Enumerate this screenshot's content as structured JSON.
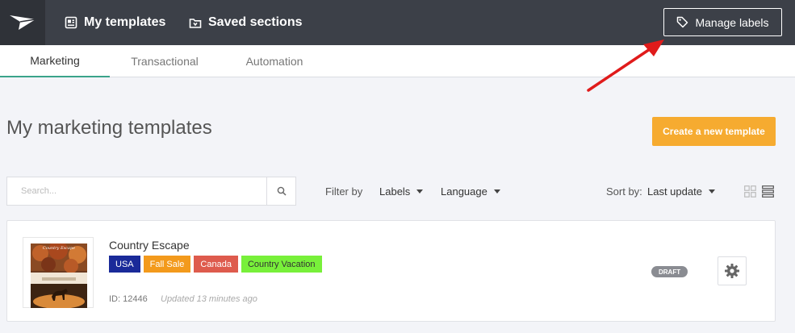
{
  "header": {
    "logo_icon": "paper-plane-icon",
    "nav": [
      {
        "label": "My templates",
        "icon": "templates-icon"
      },
      {
        "label": "Saved sections",
        "icon": "folder-icon"
      }
    ],
    "manage_labels": {
      "label": "Manage labels",
      "icon": "tag-icon"
    }
  },
  "tabs": [
    {
      "label": "Marketing",
      "active": true
    },
    {
      "label": "Transactional",
      "active": false
    },
    {
      "label": "Automation",
      "active": false
    }
  ],
  "main": {
    "title": "My marketing templates",
    "create_button": "Create a new template"
  },
  "filters": {
    "search_placeholder": "Search...",
    "filter_by": "Filter by",
    "labels": "Labels",
    "language": "Language",
    "sort_by": "Sort by:",
    "sort_value": "Last update"
  },
  "template": {
    "name": "Country Escape",
    "thumbnail_title": "Country Escape",
    "labels": [
      {
        "text": "USA",
        "color": "#1a2a99"
      },
      {
        "text": "Fall Sale",
        "color": "#f39a1c"
      },
      {
        "text": "Canada",
        "color": "#de5b4d"
      },
      {
        "text": "Country Vacation",
        "color": "#78f03a"
      }
    ],
    "id": "ID: 12446",
    "updated": "Updated 13 minutes ago",
    "status": "DRAFT"
  },
  "colors": {
    "topbar": "#3c4048",
    "accent": "#3aa38a",
    "create_button": "#f6ab30",
    "arrow": "#e01b1b"
  }
}
